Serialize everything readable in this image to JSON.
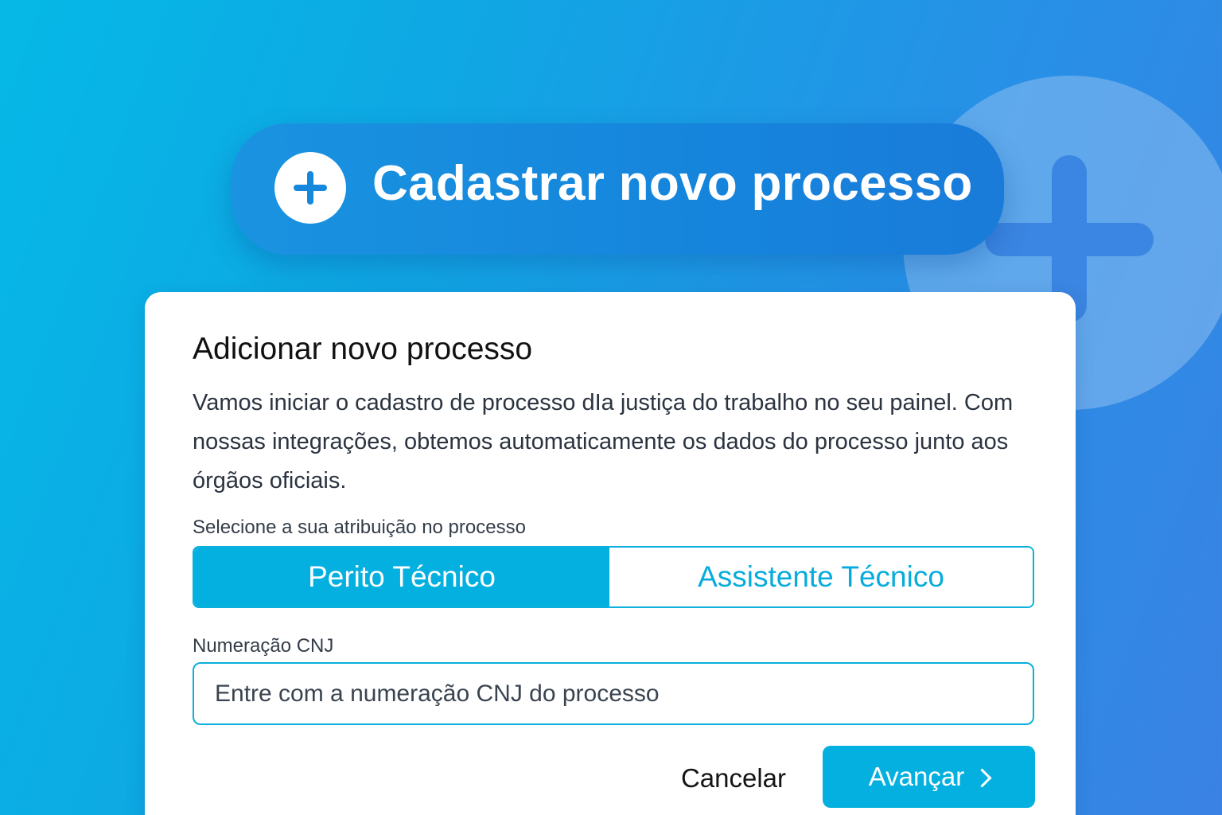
{
  "hero": {
    "title": "Cadastrar novo processo",
    "icon": "plus-circle-icon"
  },
  "background": {
    "decoration_icon": "plus-circle-icon"
  },
  "card": {
    "title": "Adicionar novo processo",
    "description": "Vamos iniciar o cadastro de processo dIa justiça do trabalho no seu painel. Com nossas integrações, obtemos automaticamente os dados do processo junto aos órgãos oficiais.",
    "role_label": "Selecione a sua atribuição no processo",
    "roles": [
      "Perito Técnico",
      "Assistente Técnico"
    ],
    "selected_role": "Perito Técnico",
    "cnj_label": "Numeração CNJ",
    "cnj_value": "",
    "cnj_placeholder": "Entre com a numeração CNJ do processo",
    "cancel_label": "Cancelar",
    "next_label": "Avançar",
    "next_icon": "chevron-right-icon"
  },
  "colors": {
    "accent": "#04b0df",
    "hero_bg": "#1585dc",
    "page_bg_start": "#05b9e6",
    "page_bg_end": "#3a82e4"
  }
}
